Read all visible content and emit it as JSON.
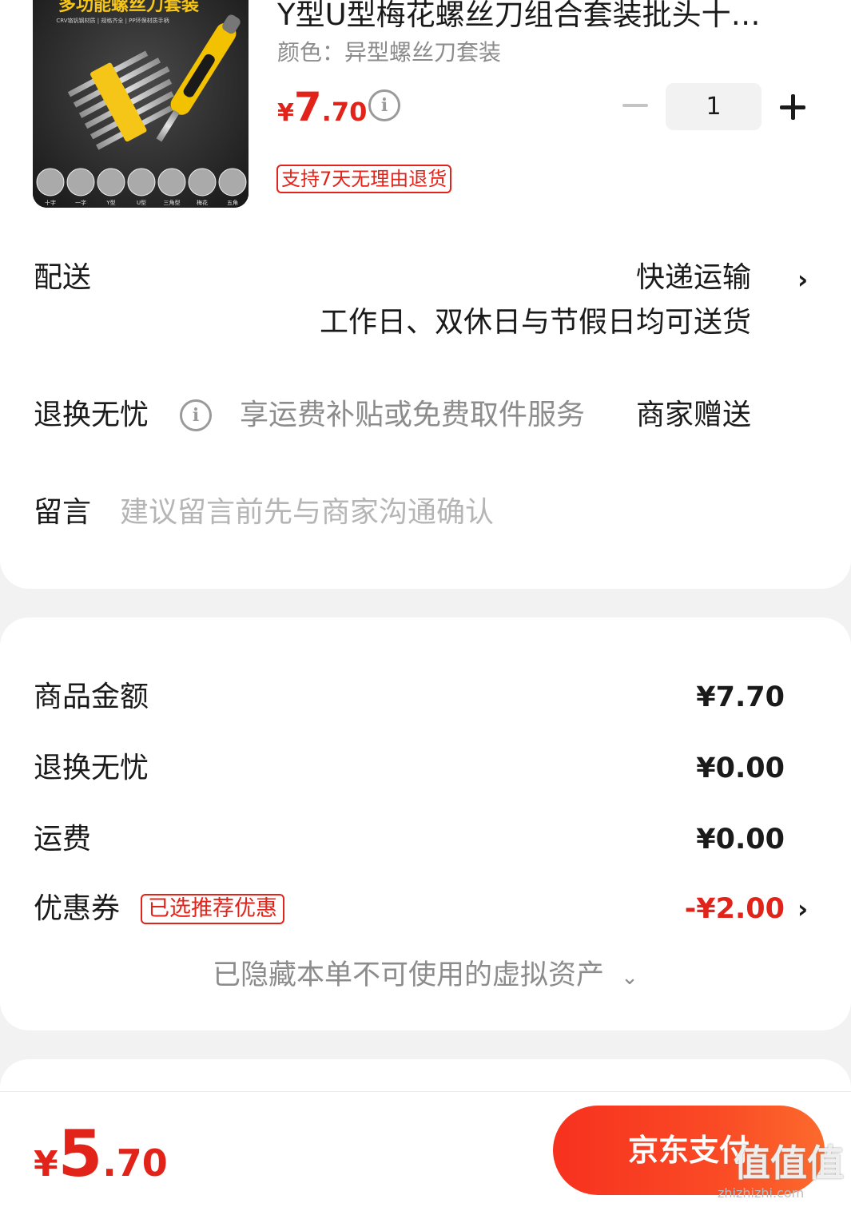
{
  "product": {
    "title": "Y型U型梅花螺丝刀组合套装批头十…",
    "spec": "颜色：异型螺丝刀套装",
    "price_currency": "¥",
    "price_int": "7",
    "price_dec": ".70",
    "quantity": "1",
    "return_tag": "支持7天无理由退货",
    "image": {
      "banner": "多功能螺丝刀套装",
      "subbanner": "CRV铬钒钢材质 | 规格齐全 | PP环保材质手柄",
      "bit_labels": [
        "十字",
        "一字",
        "Y型",
        "U型",
        "三角型",
        "梅花",
        "五角"
      ]
    }
  },
  "delivery": {
    "label": "配送",
    "method": "快递运输",
    "note": "工作日、双休日与节假日均可送货"
  },
  "return_service": {
    "label": "退换无忧",
    "desc": "享运费补贴或免费取件服务",
    "value": "商家赠送"
  },
  "message": {
    "label": "留言",
    "placeholder": "建议留言前先与商家沟通确认"
  },
  "summary": {
    "goods_label": "商品金额",
    "goods_value": "¥7.70",
    "return_label": "退换无忧",
    "return_value": "¥0.00",
    "shipping_label": "运费",
    "shipping_value": "¥0.00",
    "coupon_label": "优惠券",
    "coupon_tag": "已选推荐优惠",
    "coupon_value": "-¥2.00",
    "hidden_assets": "已隐藏本单不可使用的虚拟资产"
  },
  "footer": {
    "total_currency": "¥",
    "total_int": "5",
    "total_dec": ".70",
    "pay_label": "京东支付"
  },
  "watermark": {
    "text": "值值值",
    "url": "zhizhizhi.com"
  },
  "colors": {
    "accent_red": "#e2231a",
    "pay_gradient_start": "#f7311f",
    "pay_gradient_end": "#fc6a2c",
    "page_bg": "#f2f2f2"
  }
}
